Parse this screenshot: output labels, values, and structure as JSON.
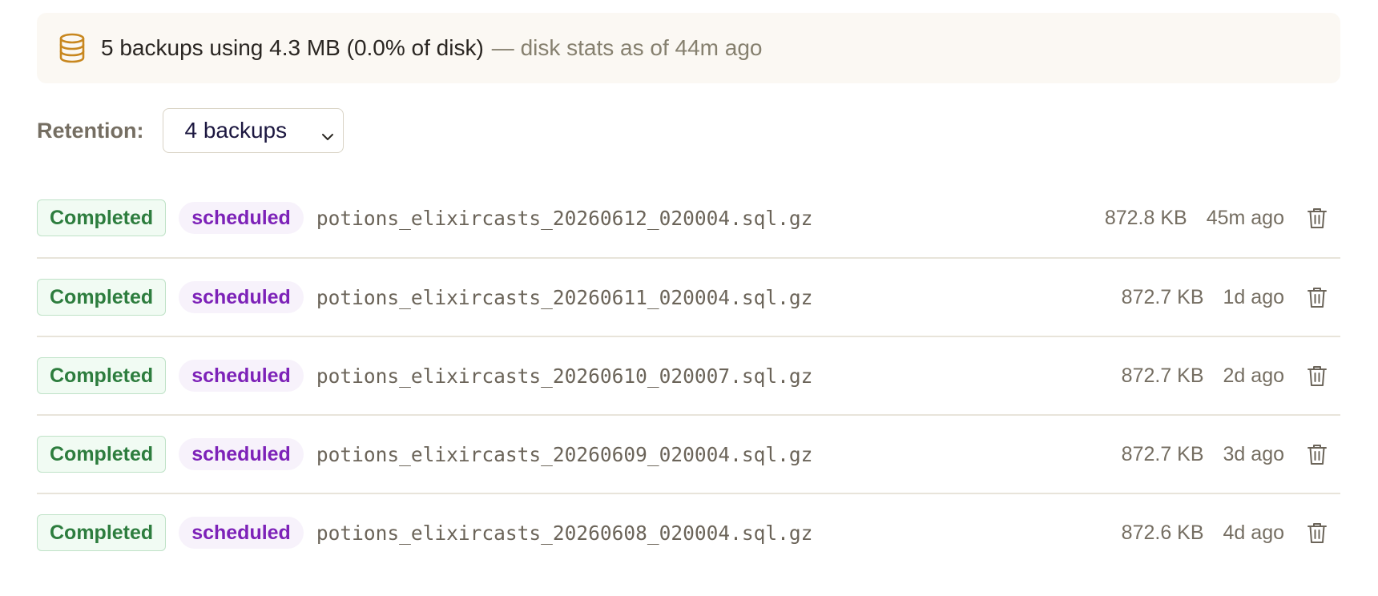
{
  "summary": {
    "icon": "database-icon",
    "text": "5 backups using 4.3 MB (0.0% of disk)",
    "subtext": "— disk stats as of 44m ago"
  },
  "retention": {
    "label": "Retention:",
    "selected": "4 backups"
  },
  "colors": {
    "completed_text": "#2d7d3e",
    "scheduled_text": "#7d22b8",
    "icon_accent": "#c8871f"
  },
  "backups": [
    {
      "status": "Completed",
      "trigger": "scheduled",
      "filename": "potions_elixircasts_20260612_020004.sql.gz",
      "size": "872.8 KB",
      "age": "45m ago"
    },
    {
      "status": "Completed",
      "trigger": "scheduled",
      "filename": "potions_elixircasts_20260611_020004.sql.gz",
      "size": "872.7 KB",
      "age": "1d ago"
    },
    {
      "status": "Completed",
      "trigger": "scheduled",
      "filename": "potions_elixircasts_20260610_020007.sql.gz",
      "size": "872.7 KB",
      "age": "2d ago"
    },
    {
      "status": "Completed",
      "trigger": "scheduled",
      "filename": "potions_elixircasts_20260609_020004.sql.gz",
      "size": "872.7 KB",
      "age": "3d ago"
    },
    {
      "status": "Completed",
      "trigger": "scheduled",
      "filename": "potions_elixircasts_20260608_020004.sql.gz",
      "size": "872.6 KB",
      "age": "4d ago"
    }
  ]
}
